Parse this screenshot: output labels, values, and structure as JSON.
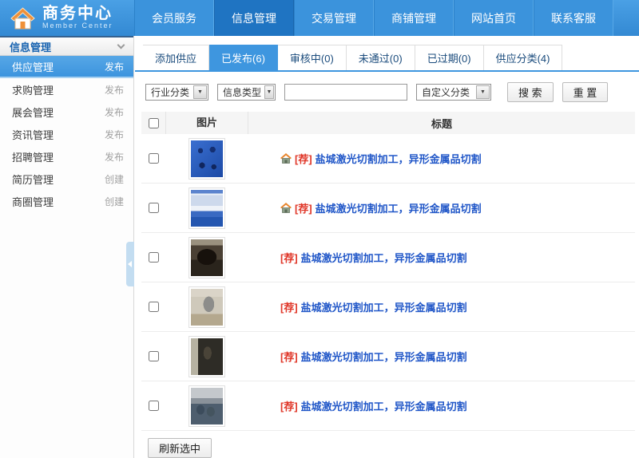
{
  "colors": {
    "accent_blue": "#3e96df",
    "nav_active_blue": "#1f74c2",
    "sidebar_active_blue": "#3c94de",
    "link_blue": "#2157c8",
    "badge_red": "#e0382a"
  },
  "header": {
    "logo": {
      "title": "商务中心",
      "subtitle": "Member Center"
    },
    "nav": [
      {
        "label": "会员服务",
        "active": false
      },
      {
        "label": "信息管理",
        "active": true
      },
      {
        "label": "交易管理",
        "active": false
      },
      {
        "label": "商铺管理",
        "active": false
      },
      {
        "label": "网站首页",
        "active": false
      },
      {
        "label": "联系客服",
        "active": false
      }
    ]
  },
  "sidebar": {
    "title": "信息管理",
    "items": [
      {
        "label": "供应管理",
        "action": "发布",
        "active": true
      },
      {
        "label": "求购管理",
        "action": "发布",
        "active": false
      },
      {
        "label": "展会管理",
        "action": "发布",
        "active": false
      },
      {
        "label": "资讯管理",
        "action": "发布",
        "active": false
      },
      {
        "label": "招聘管理",
        "action": "发布",
        "active": false
      },
      {
        "label": "简历管理",
        "action": "创建",
        "active": false
      },
      {
        "label": "商圈管理",
        "action": "创建",
        "active": false
      }
    ]
  },
  "tabs": [
    {
      "label": "添加供应",
      "active": false
    },
    {
      "label": "已发布(6)",
      "active": true
    },
    {
      "label": "审核中(0)",
      "active": false
    },
    {
      "label": "未通过(0)",
      "active": false
    },
    {
      "label": "已过期(0)",
      "active": false
    },
    {
      "label": "供应分类(4)",
      "active": false
    }
  ],
  "filters": {
    "industry_select": "行业分类",
    "type_select": "信息类型",
    "keyword_value": "",
    "custom_select": "自定义分类",
    "search_label": "搜 索",
    "reset_label": "重 置"
  },
  "table": {
    "columns": {
      "image": "图片",
      "title": "标题"
    },
    "rows": [
      {
        "badge": "[荐]",
        "title": "盐城激光切割加工，异形金属品切割",
        "home_icon": true,
        "thumb": "t1",
        "image_desc": "blue panel with cut metal characters"
      },
      {
        "badge": "[荐]",
        "title": "盐城激光切割加工，异形金属品切割",
        "home_icon": true,
        "thumb": "t2",
        "image_desc": "blue and white ornamental railing band"
      },
      {
        "badge": "[荐]",
        "title": "盐城激光切割加工，异形金属品切割",
        "home_icon": false,
        "thumb": "t3",
        "image_desc": "dark fan-shaped iron lattice"
      },
      {
        "badge": "[荐]",
        "title": "盐城激光切割加工，异形金属品切割",
        "home_icon": false,
        "thumb": "t4",
        "image_desc": "workshop machine on light background"
      },
      {
        "badge": "[荐]",
        "title": "盐城激光切割加工，异形金属品切割",
        "home_icon": false,
        "thumb": "t5",
        "image_desc": "dark interior with metal branches"
      },
      {
        "badge": "[荐]",
        "title": "盐城激光切割加工，异形金属品切割",
        "home_icon": false,
        "thumb": "t6",
        "image_desc": "stacked grey metal parts outdoors"
      }
    ]
  },
  "footer": {
    "refresh_label": "刷新选中"
  }
}
